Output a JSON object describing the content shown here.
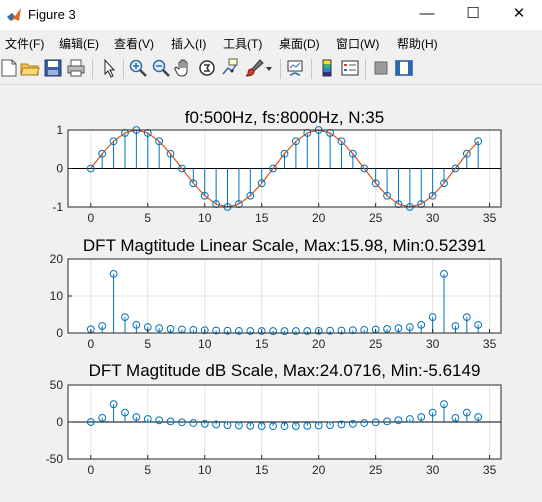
{
  "window": {
    "title": "Figure 3",
    "minimize": "—",
    "maximize": "☐",
    "close": "✕"
  },
  "menu": [
    {
      "id": "file",
      "label": "文件(F)"
    },
    {
      "id": "edit",
      "label": "编辑(E)"
    },
    {
      "id": "view",
      "label": "查看(V)"
    },
    {
      "id": "insert",
      "label": "插入(I)"
    },
    {
      "id": "tools",
      "label": "工具(T)"
    },
    {
      "id": "desktop",
      "label": "桌面(D)"
    },
    {
      "id": "window",
      "label": "窗口(W)"
    },
    {
      "id": "help",
      "label": "帮助(H)"
    }
  ],
  "toolbar": [
    "new-figure-icon",
    "open-file-icon",
    "save-icon",
    "print-icon",
    "select-arrow-icon",
    "zoom-in-icon",
    "zoom-out-icon",
    "pan-hand-icon",
    "rotate-3d-icon",
    "data-cursor-icon",
    "brush-icon",
    "brush-dropdown-icon",
    "link-plot-icon",
    "colorbar-icon",
    "legend-icon",
    "hide-plot-tools-icon",
    "show-plot-tools-icon"
  ],
  "colors": {
    "stem": "#0072bd",
    "line": "#d95319",
    "grid": "#e3e3e3"
  },
  "chart_data": [
    {
      "type": "stem",
      "title": "f0:500Hz, fs:8000Hz, N:35",
      "xlim": [
        -2,
        36
      ],
      "ylim": [
        -1,
        1
      ],
      "xticks": [
        0,
        5,
        10,
        15,
        20,
        25,
        30,
        35
      ],
      "yticks": [
        -1,
        0,
        1
      ],
      "grid": true,
      "x": [
        0,
        1,
        2,
        3,
        4,
        5,
        6,
        7,
        8,
        9,
        10,
        11,
        12,
        13,
        14,
        15,
        16,
        17,
        18,
        19,
        20,
        21,
        22,
        23,
        24,
        25,
        26,
        27,
        28,
        29,
        30,
        31,
        32,
        33,
        34
      ],
      "series": [
        {
          "values": [
            0,
            0.3827,
            0.7071,
            0.9239,
            1,
            0.9239,
            0.7071,
            0.3827,
            0,
            -0.3827,
            -0.7071,
            -0.9239,
            -1,
            -0.9239,
            -0.7071,
            -0.3827,
            0,
            0.3827,
            0.7071,
            0.9239,
            1,
            0.9239,
            0.7071,
            0.3827,
            0,
            -0.3827,
            -0.7071,
            -0.9239,
            -1,
            -0.9239,
            -0.7071,
            -0.3827,
            0,
            0.3827,
            0.7071
          ]
        }
      ],
      "overlay_line": true
    },
    {
      "type": "stem",
      "title": "DFT Magtitude Linear Scale,  Max:15.98, Min:0.52391",
      "xlim": [
        -2,
        36
      ],
      "ylim": [
        0,
        20
      ],
      "xticks": [
        0,
        5,
        10,
        15,
        20,
        25,
        30,
        35
      ],
      "yticks": [
        0,
        10,
        20
      ],
      "grid": true,
      "x": [
        0,
        1,
        2,
        3,
        4,
        5,
        6,
        7,
        8,
        9,
        10,
        11,
        12,
        13,
        14,
        15,
        16,
        17,
        18,
        19,
        20,
        21,
        22,
        23,
        24,
        25,
        26,
        27,
        28,
        29,
        30,
        31,
        32,
        33,
        34
      ],
      "series": [
        {
          "values": [
            1.0,
            1.9,
            15.98,
            4.3,
            2.2,
            1.6,
            1.3,
            1.1,
            0.95,
            0.85,
            0.75,
            0.68,
            0.62,
            0.58,
            0.55,
            0.53,
            0.52391,
            0.52391,
            0.53,
            0.55,
            0.58,
            0.62,
            0.68,
            0.75,
            0.85,
            0.95,
            1.1,
            1.3,
            1.6,
            2.2,
            4.3,
            15.98,
            1.9,
            4.3,
            2.2
          ]
        }
      ]
    },
    {
      "type": "stem",
      "title": "DFT Magtitude dB Scale,  Max:24.0716, Min:-5.6149",
      "xlim": [
        -2,
        36
      ],
      "ylim": [
        -50,
        50
      ],
      "xticks": [
        0,
        5,
        10,
        15,
        20,
        25,
        30,
        35
      ],
      "yticks": [
        -50,
        0,
        50
      ],
      "grid": true,
      "x": [
        0,
        1,
        2,
        3,
        4,
        5,
        6,
        7,
        8,
        9,
        10,
        11,
        12,
        13,
        14,
        15,
        16,
        17,
        18,
        19,
        20,
        21,
        22,
        23,
        24,
        25,
        26,
        27,
        28,
        29,
        30,
        31,
        32,
        33,
        34
      ],
      "series": [
        {
          "values": [
            0,
            5.6,
            24.0716,
            12.7,
            6.8,
            4.1,
            2.3,
            0.8,
            -0.4,
            -1.4,
            -2.5,
            -3.3,
            -4.2,
            -4.7,
            -5.2,
            -5.5,
            -5.6149,
            -5.6149,
            -5.5,
            -5.2,
            -4.7,
            -4.2,
            -3.3,
            -2.5,
            -1.4,
            -0.4,
            0.8,
            2.3,
            4.1,
            6.8,
            12.7,
            24.0716,
            5.6,
            12.7,
            6.8
          ]
        }
      ]
    }
  ]
}
